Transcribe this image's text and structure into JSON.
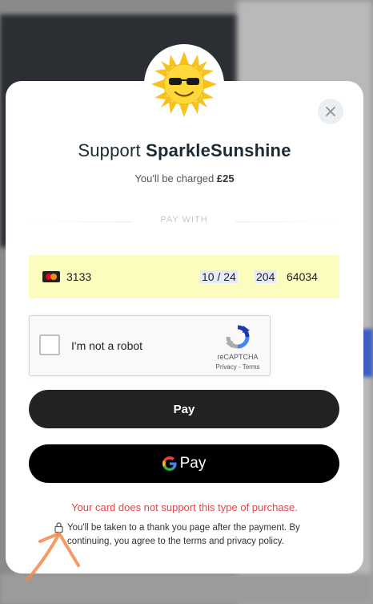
{
  "creator": {
    "support_prefix": "Support",
    "name": "SparkleSunshine"
  },
  "charge": {
    "prefix": "You'll be charged",
    "amount": "£25"
  },
  "pay_with_label": "PAY WITH",
  "card": {
    "brand_icon": "mastercard-icon",
    "last4": "3133",
    "expiry": "10 / 24",
    "cvc": "204",
    "postcode": "64034"
  },
  "captcha": {
    "label": "I'm not a robot",
    "brand": "reCAPTCHA",
    "links": "Privacy - Terms"
  },
  "buttons": {
    "pay": "Pay",
    "google_pay": "Pay"
  },
  "error_message": "Your card does not support this type of purchase.",
  "footer_note": "You'll be taken to a thank you page after the payment. By continuing, you agree to the terms and privacy policy.",
  "colors": {
    "error": "#e0454a",
    "card_autofill": "#fbfcbd",
    "button_dark": "#222222"
  },
  "icons": [
    "sun-avatar-icon",
    "close-icon",
    "mastercard-icon",
    "recaptcha-logo-icon",
    "google-g-icon",
    "lock-icon",
    "arrow-annotation-icon"
  ]
}
